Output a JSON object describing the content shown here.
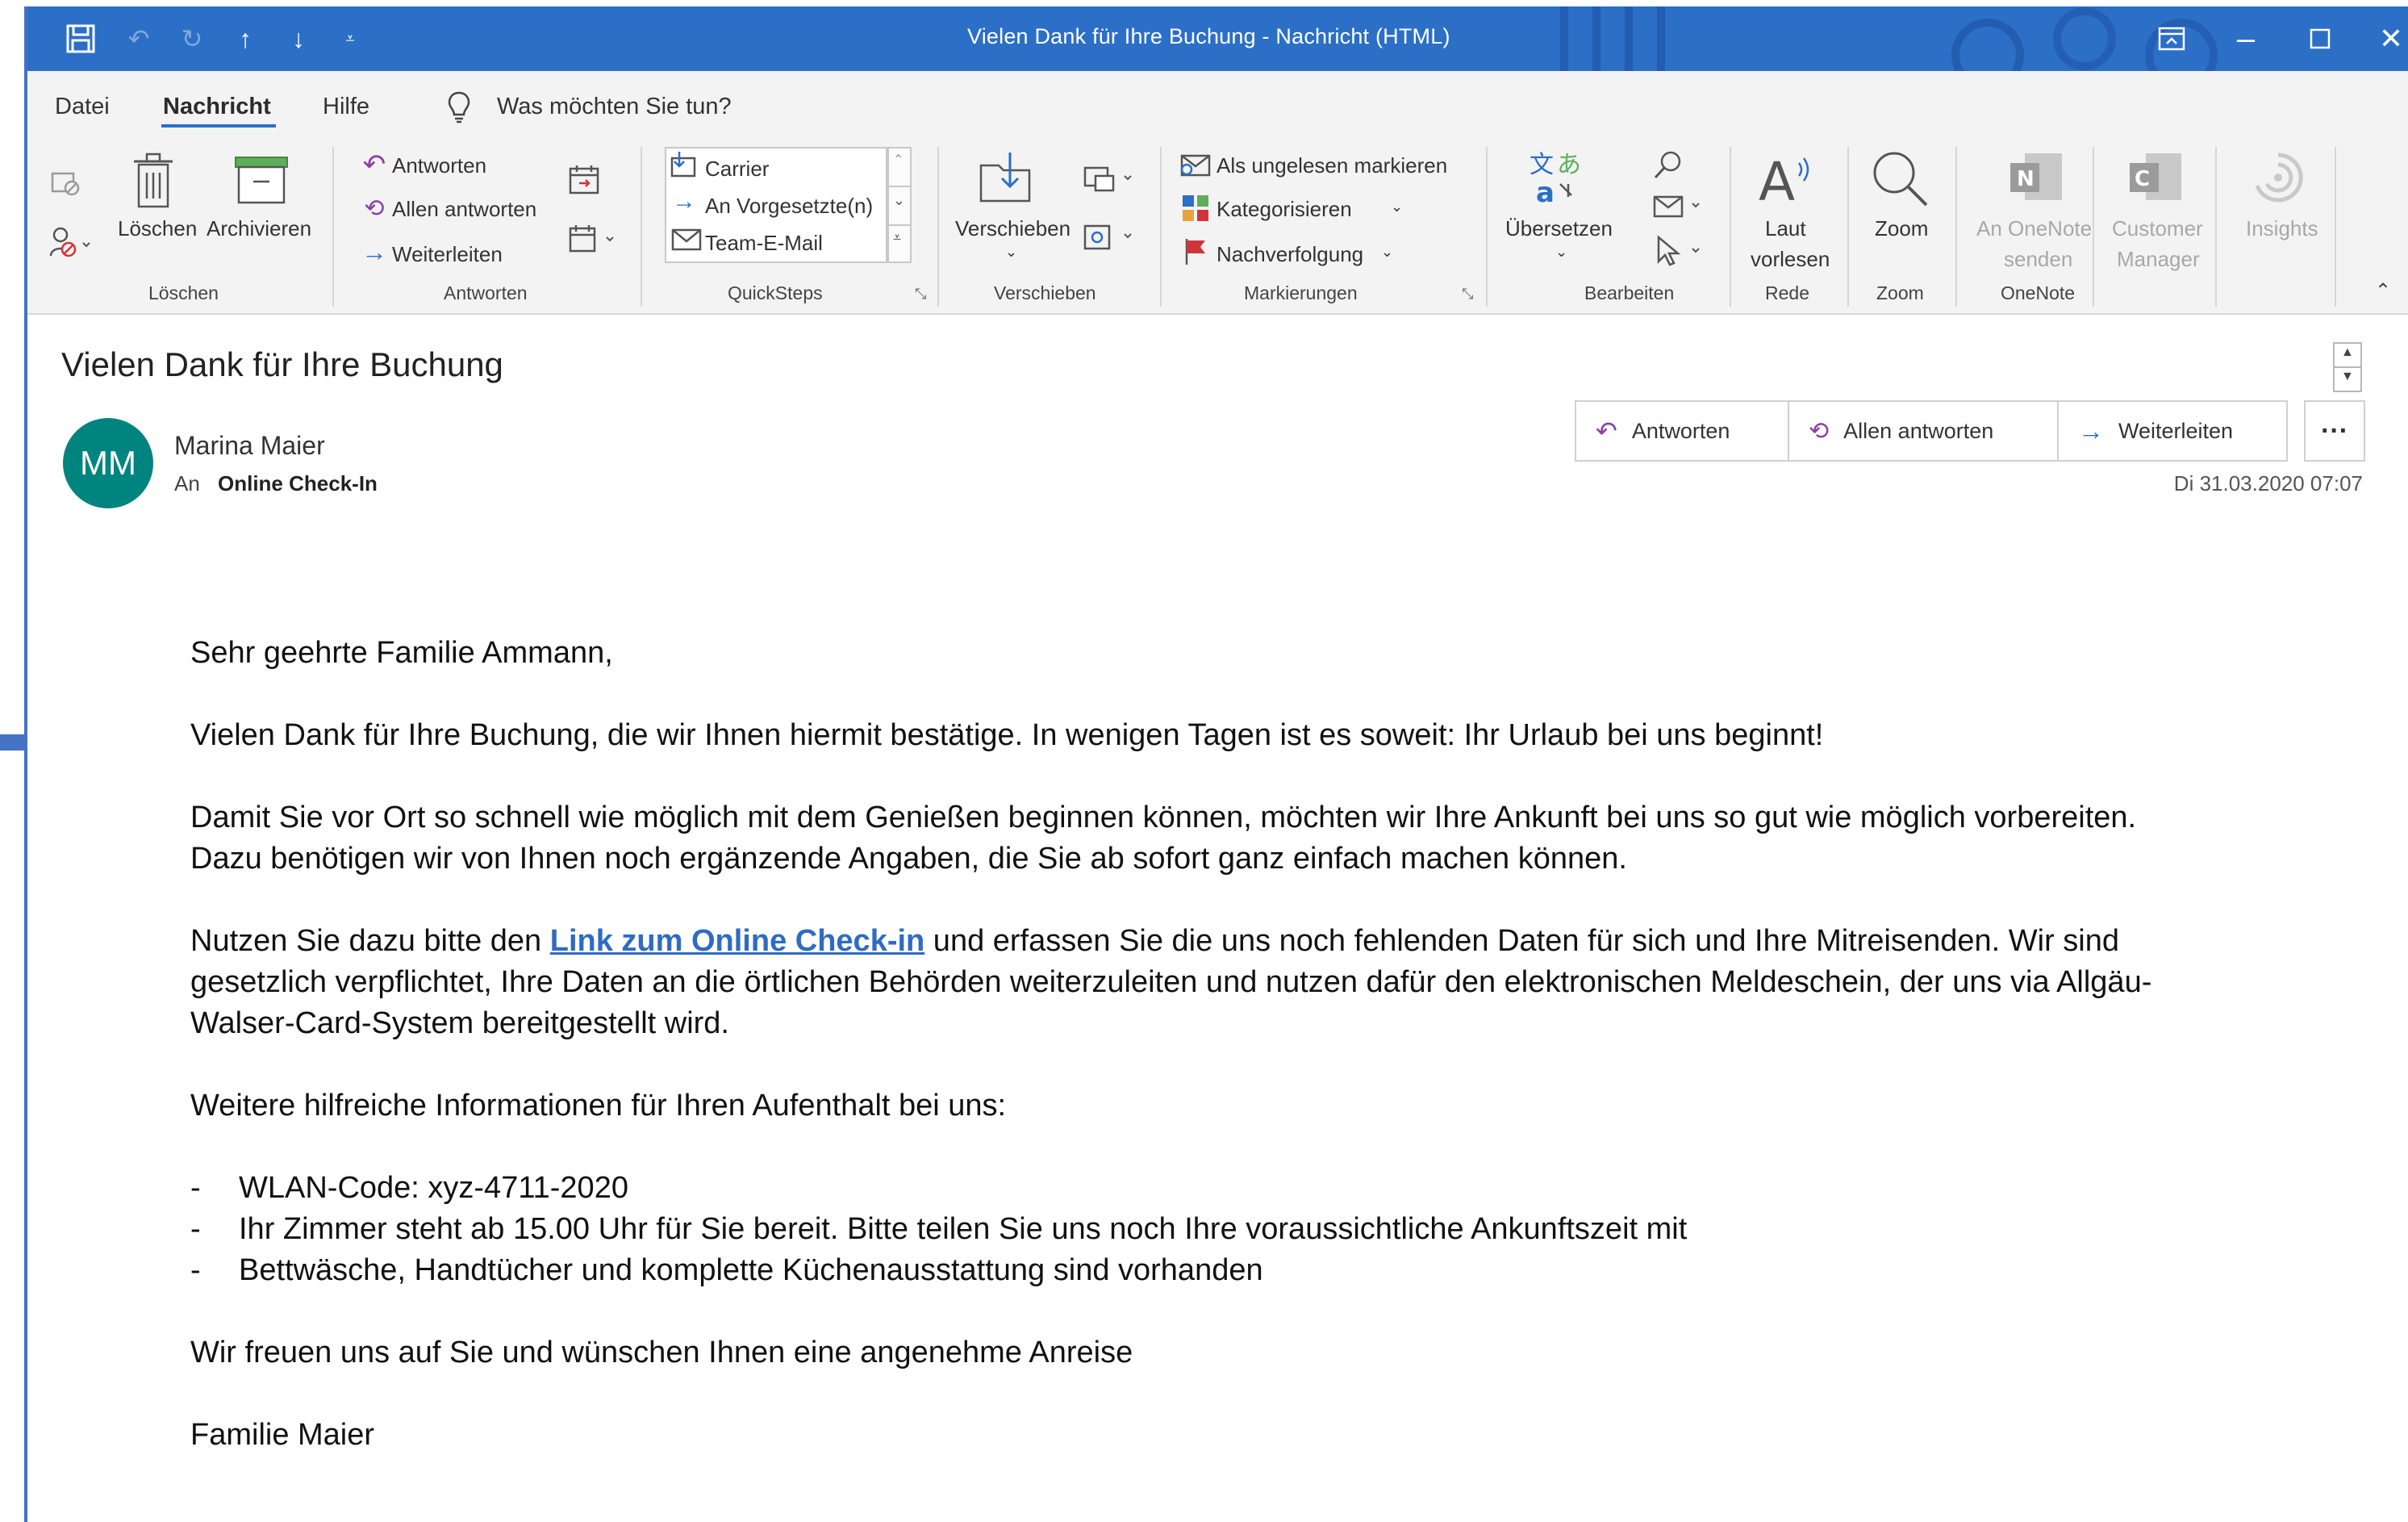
{
  "window": {
    "title": "Vielen Dank für Ihre Buchung  -  Nachricht (HTML)"
  },
  "menu": {
    "items": [
      "Datei",
      "Nachricht",
      "Hilfe"
    ],
    "search_placeholder": "Was möchten Sie tun?"
  },
  "ribbon": {
    "loeschen": {
      "delete": "Löschen",
      "archive": "Archivieren",
      "group": "Löschen"
    },
    "antworten": {
      "reply": "Antworten",
      "reply_all": "Allen antworten",
      "forward": "Weiterleiten",
      "group": "Antworten"
    },
    "quicksteps": {
      "items": [
        "Carrier",
        "An Vorgesetzte(n)",
        "Team-E-Mail"
      ],
      "group": "QuickSteps"
    },
    "verschieben": {
      "move": "Verschieben",
      "group": "Verschieben"
    },
    "markierungen": {
      "unread": "Als ungelesen markieren",
      "categorize": "Kategorisieren",
      "followup": "Nachverfolgung",
      "group": "Markierungen"
    },
    "bearbeiten": {
      "translate": "Übersetzen",
      "group": "Bearbeiten"
    },
    "rede": {
      "read_line1": "Laut",
      "read_line2": "vorlesen",
      "group": "Rede"
    },
    "zoom": {
      "zoom": "Zoom",
      "group": "Zoom"
    },
    "onenote": {
      "line1": "An OneNote",
      "line2": "senden",
      "group": "OneNote"
    },
    "customer": {
      "line1": "Customer",
      "line2": "Manager"
    },
    "insights": {
      "label": "Insights"
    }
  },
  "message": {
    "subject": "Vielen Dank für Ihre Buchung",
    "avatar_initials": "MM",
    "sender": "Marina Maier",
    "to_label": "An",
    "to_name": "Online Check-In",
    "date": "Di 31.03.2020 07:07",
    "actions": {
      "reply": "Antworten",
      "reply_all": "Allen antworten",
      "forward": "Weiterleiten",
      "more": "···"
    }
  },
  "body": {
    "greeting": "Sehr geehrte Familie Ammann,",
    "p1": "Vielen Dank für Ihre Buchung, die wir Ihnen hiermit bestätige. In wenigen Tagen ist es soweit: Ihr Urlaub bei uns beginnt!",
    "p2_line1": "Damit Sie vor Ort so schnell wie möglich mit dem Genießen beginnen können, möchten wir Ihre Ankunft bei uns so gut wie möglich vorbereiten.",
    "p2_line2": "Dazu benötigen wir von Ihnen noch ergänzende Angaben, die Sie ab sofort ganz einfach machen können.",
    "p3_pre": "Nutzen Sie dazu bitte den ",
    "p3_link": "Link zum Online Check-in",
    "p3_post1": " und erfassen Sie die uns noch fehlenden Daten für sich und Ihre Mitreisenden. Wir sind",
    "p3_line2": "gesetzlich verpflichtet, Ihre Daten an die örtlichen Behörden weiterzuleiten und nutzen dafür den elektronischen Meldeschein, der uns via Allgäu-",
    "p3_line3": "Walser-Card-System bereitgestellt wird.",
    "p4": "Weitere hilfreiche Informationen für Ihren Aufenthalt bei uns:",
    "list": [
      "WLAN-Code:  xyz-4711-2020",
      "Ihr Zimmer steht ab 15.00 Uhr für Sie bereit. Bitte teilen Sie uns noch Ihre voraussichtliche Ankunftszeit mit",
      "Bettwäsche, Handtücher und komplette Küchenausstattung sind vorhanden"
    ],
    "list_marker": "-",
    "closing": "Wir freuen uns auf Sie und wünschen Ihnen eine angenehme Anreise",
    "signature": "Familie Maier"
  },
  "colors": {
    "titlebar": "#2b6fc7",
    "avatar": "#00847f",
    "link": "#2f6bc2",
    "annotation_arrow": "#4472c4"
  }
}
